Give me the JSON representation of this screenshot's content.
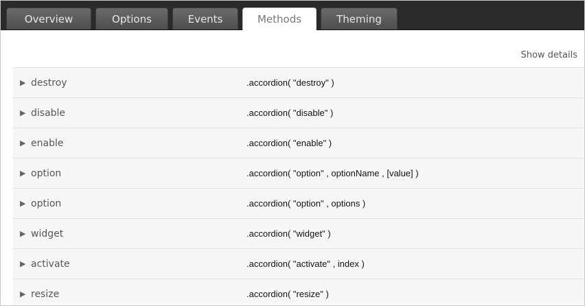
{
  "tabs": [
    {
      "label": "Overview",
      "active": false
    },
    {
      "label": "Options",
      "active": false
    },
    {
      "label": "Events",
      "active": false
    },
    {
      "label": "Methods",
      "active": true
    },
    {
      "label": "Theming",
      "active": false
    }
  ],
  "show_details_label": "Show details",
  "methods": [
    {
      "name": "destroy",
      "signature": ".accordion( \"destroy\" )"
    },
    {
      "name": "disable",
      "signature": ".accordion( \"disable\" )"
    },
    {
      "name": "enable",
      "signature": ".accordion( \"enable\" )"
    },
    {
      "name": "option",
      "signature": ".accordion( \"option\" , optionName , [value] )"
    },
    {
      "name": "option",
      "signature": ".accordion( \"option\" , options )"
    },
    {
      "name": "widget",
      "signature": ".accordion( \"widget\" )"
    },
    {
      "name": "activate",
      "signature": ".accordion( \"activate\" , index )"
    },
    {
      "name": "resize",
      "signature": ".accordion( \"resize\" )"
    }
  ],
  "icons": {
    "expand": "triangle-right-icon"
  },
  "colors": {
    "tabbar_bg": "#2a2a2a",
    "row_bg": "#f7f7f7",
    "active_tab_bg": "#ffffff"
  }
}
